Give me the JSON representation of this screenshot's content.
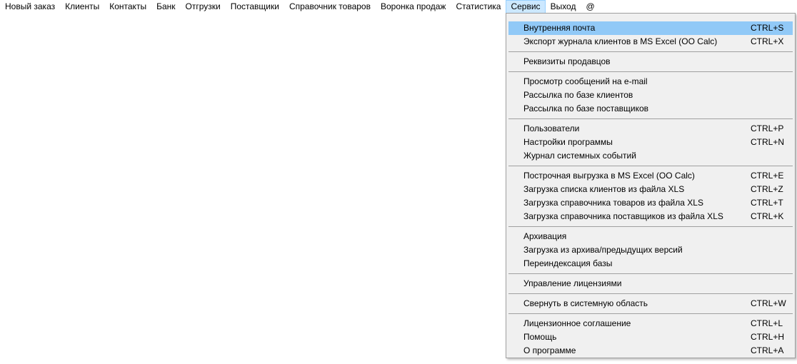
{
  "menubar": {
    "items": [
      {
        "label": "Новый заказ"
      },
      {
        "label": "Клиенты"
      },
      {
        "label": "Контакты"
      },
      {
        "label": "Банк"
      },
      {
        "label": "Отгрузки"
      },
      {
        "label": "Поставщики"
      },
      {
        "label": "Справочник товаров"
      },
      {
        "label": "Воронка продаж"
      },
      {
        "label": "Статистика"
      },
      {
        "label": "Сервис",
        "active": true
      },
      {
        "label": "Выход"
      },
      {
        "label": "@"
      }
    ]
  },
  "service_menu": {
    "groups": [
      [
        {
          "label": "Внутренняя почта",
          "shortcut": "CTRL+S",
          "highlighted": true
        },
        {
          "label": "Экспорт журнала клиентов в MS Excel (OO Calc)",
          "shortcut": "CTRL+X"
        }
      ],
      [
        {
          "label": "Реквизиты продавцов",
          "shortcut": ""
        }
      ],
      [
        {
          "label": "Просмотр сообщений на e-mail",
          "shortcut": ""
        },
        {
          "label": "Рассылка по базе клиентов",
          "shortcut": ""
        },
        {
          "label": "Рассылка по базе поставщиков",
          "shortcut": ""
        }
      ],
      [
        {
          "label": "Пользователи",
          "shortcut": "CTRL+P"
        },
        {
          "label": "Настройки программы",
          "shortcut": "CTRL+N"
        },
        {
          "label": "Журнал системных событий",
          "shortcut": ""
        }
      ],
      [
        {
          "label": "Построчная выгрузка в MS Excel (OO Calc)",
          "shortcut": "CTRL+E"
        },
        {
          "label": "Загрузка списка клиентов из файла XLS",
          "shortcut": "CTRL+Z"
        },
        {
          "label": "Загрузка справочника товаров из файла XLS",
          "shortcut": "CTRL+T"
        },
        {
          "label": "Загрузка справочника поставщиков из файла XLS",
          "shortcut": "CTRL+K"
        }
      ],
      [
        {
          "label": "Архивация",
          "shortcut": ""
        },
        {
          "label": "Загрузка из архива/предыдущих версий",
          "shortcut": ""
        },
        {
          "label": "Переиндексация базы",
          "shortcut": ""
        }
      ],
      [
        {
          "label": "Управление лицензиями",
          "shortcut": ""
        }
      ],
      [
        {
          "label": "Свернуть в системную область",
          "shortcut": "CTRL+W"
        }
      ],
      [
        {
          "label": "Лицензионное соглашение",
          "shortcut": "CTRL+L"
        },
        {
          "label": "Помощь",
          "shortcut": "CTRL+H"
        },
        {
          "label": "О программе",
          "shortcut": "CTRL+A"
        }
      ]
    ]
  },
  "colors": {
    "highlight": "#91c9f7",
    "menubar_active": "#cce8ff",
    "menu_background": "#f0f0f0"
  }
}
